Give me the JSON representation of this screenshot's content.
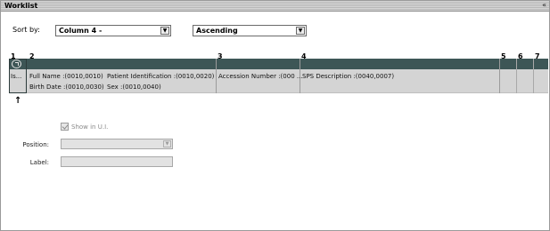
{
  "window": {
    "title": "Worklist",
    "collapse_glyph": "«"
  },
  "sort": {
    "label": "Sort by:",
    "column_value": "Column 4 -",
    "direction_value": "Ascending",
    "arrow_glyph": "▼"
  },
  "columns": {
    "numbers": [
      "1",
      "2",
      "3",
      "4",
      "5",
      "6",
      "7"
    ]
  },
  "row": {
    "c1": "Is...",
    "c2_line1": "Full Name :(0010,0010)",
    "c2_line2": "Birth Date :(0010,0030)",
    "c2b_line1": "Patient Identification :(0010,0020)",
    "c2b_line2": "Sex :(0010,0040)",
    "c3": "Accession  Number  :(000 ...",
    "c4": "SPS Description :(0040,0007)"
  },
  "move_up_glyph": "🠕",
  "form": {
    "show_label": "Show in U.I.",
    "show_checked": true,
    "position_label": "Position:",
    "label_label": "Label:"
  },
  "icons": {
    "collapse": "chevron-collapse-icon",
    "header_select": "refresh-icon",
    "move_up": "up-arrow-icon"
  },
  "colors": {
    "header": "#3d5656",
    "row": "#d4d4d4"
  }
}
